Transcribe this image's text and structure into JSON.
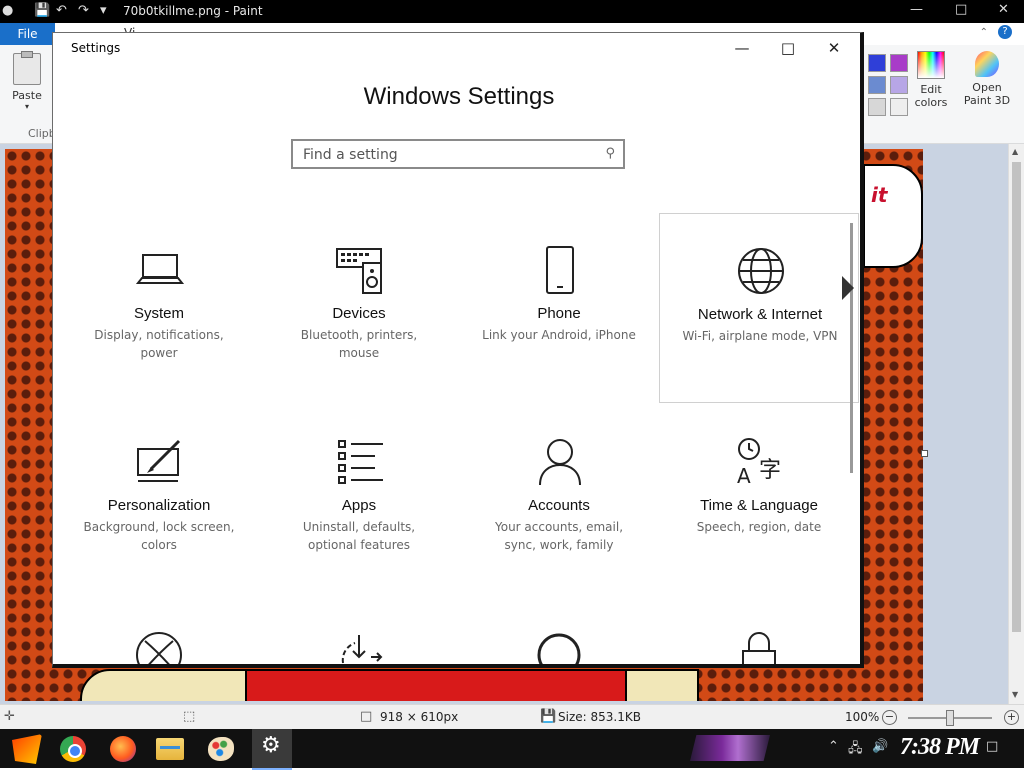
{
  "paint": {
    "title": "70b0tkillme.png - Paint",
    "file_tab": "File",
    "tab_stub": "Vi",
    "help": "?",
    "paste_label": "Paste",
    "clipboard_label": "Clipboard",
    "edit_colors_label": "Edit colors",
    "open_paint3d_label": "Open Paint 3D",
    "swatches": [
      "#2f3fd8",
      "#a83cc8",
      "#6b8bd0",
      "#b7a6e6",
      "#d7d7d7",
      "#eeeeee"
    ],
    "canvas_text": "it",
    "status": {
      "size": "918 × 610px",
      "filesize": "Size: 853.1KB",
      "zoom": "100%"
    }
  },
  "settings": {
    "window_title": "Settings",
    "heading": "Windows Settings",
    "search_placeholder": "Find a setting",
    "tiles": [
      {
        "name": "System",
        "desc": "Display, notifications, power",
        "icon": "laptop-icon"
      },
      {
        "name": "Devices",
        "desc": "Bluetooth, printers, mouse",
        "icon": "keyboard-speaker-icon"
      },
      {
        "name": "Phone",
        "desc": "Link your Android, iPhone",
        "icon": "phone-icon"
      },
      {
        "name": "Network & Internet",
        "desc": "Wi-Fi, airplane mode, VPN",
        "icon": "globe-icon"
      },
      {
        "name": "Personalization",
        "desc": "Background, lock screen, colors",
        "icon": "paint-brush-icon"
      },
      {
        "name": "Apps",
        "desc": "Uninstall, defaults, optional features",
        "icon": "app-list-icon"
      },
      {
        "name": "Accounts",
        "desc": "Your accounts, email, sync, work, family",
        "icon": "person-icon"
      },
      {
        "name": "Time & Language",
        "desc": "Speech, region, date",
        "icon": "clock-language-icon"
      }
    ],
    "partial_tiles": [
      "xbox-icon",
      "update-icon",
      "search-circle-icon",
      "lock-icon"
    ]
  },
  "taskbar": {
    "clock": "7:38 PM",
    "apps": [
      "start-button",
      "chrome-icon",
      "firefox-icon",
      "file-explorer-icon",
      "paint-icon",
      "settings-icon"
    ]
  }
}
